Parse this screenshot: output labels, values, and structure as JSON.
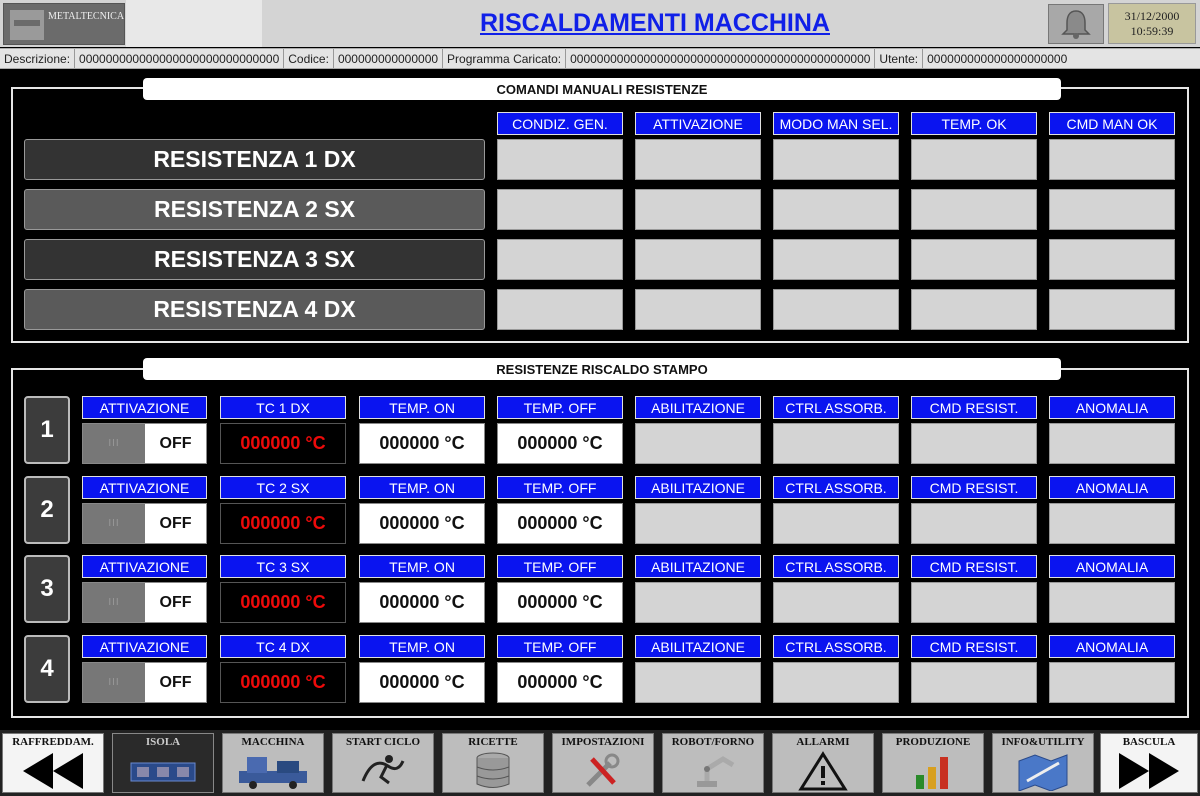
{
  "header": {
    "logo_text": "METALTECNICA",
    "title": "RISCALDAMENTI MACCHINA",
    "date": "31/12/2000",
    "time": "10:59:39"
  },
  "info_bar": {
    "descrizione_label": "Descrizione:",
    "descrizione_value": "000000000000000000000000000000",
    "codice_label": "Codice:",
    "codice_value": "000000000000000",
    "programma_label": "Programma Caricato:",
    "programma_value": "000000000000000000000000000000000000000000000",
    "utente_label": "Utente:",
    "utente_value": "000000000000000000000"
  },
  "manual": {
    "title": "COMANDI MANUALI RESISTENZE",
    "columns": [
      "CONDIZ. GEN.",
      "ATTIVAZIONE",
      "MODO MAN SEL.",
      "TEMP. OK",
      "CMD MAN OK"
    ],
    "rows": [
      "RESISTENZA 1 DX",
      "RESISTENZA 2 SX",
      "RESISTENZA 3 SX",
      "RESISTENZA 4 DX"
    ]
  },
  "mold": {
    "title": "RESISTENZE RISCALDO STAMPO",
    "rows": [
      {
        "num": "1",
        "attivazione": "ATTIVAZIONE",
        "toggle": "OFF",
        "tc_label": "TC 1 DX",
        "tc_value": "000000 °C",
        "temp_on_label": "TEMP. ON",
        "temp_on": "000000 °C",
        "temp_off_label": "TEMP. OFF",
        "temp_off": "000000 °C",
        "abil": "ABILITAZIONE",
        "ctrl": "CTRL ASSORB.",
        "cmd": "CMD RESIST.",
        "anom": "ANOMALIA"
      },
      {
        "num": "2",
        "attivazione": "ATTIVAZIONE",
        "toggle": "OFF",
        "tc_label": "TC 2 SX",
        "tc_value": "000000 °C",
        "temp_on_label": "TEMP. ON",
        "temp_on": "000000 °C",
        "temp_off_label": "TEMP. OFF",
        "temp_off": "000000 °C",
        "abil": "ABILITAZIONE",
        "ctrl": "CTRL ASSORB.",
        "cmd": "CMD RESIST.",
        "anom": "ANOMALIA"
      },
      {
        "num": "3",
        "attivazione": "ATTIVAZIONE",
        "toggle": "OFF",
        "tc_label": "TC 3 SX",
        "tc_value": "000000 °C",
        "temp_on_label": "TEMP. ON",
        "temp_on": "000000 °C",
        "temp_off_label": "TEMP. OFF",
        "temp_off": "000000 °C",
        "abil": "ABILITAZIONE",
        "ctrl": "CTRL ASSORB.",
        "cmd": "CMD RESIST.",
        "anom": "ANOMALIA"
      },
      {
        "num": "4",
        "attivazione": "ATTIVAZIONE",
        "toggle": "OFF",
        "tc_label": "TC 4 DX",
        "tc_value": "000000 °C",
        "temp_on_label": "TEMP. ON",
        "temp_on": "000000 °C",
        "temp_off_label": "TEMP. OFF",
        "temp_off": "000000 °C",
        "abil": "ABILITAZIONE",
        "ctrl": "CTRL ASSORB.",
        "cmd": "CMD RESIST.",
        "anom": "ANOMALIA"
      }
    ]
  },
  "nav": [
    {
      "label": "RAFFREDDAM.",
      "icon": "double-left-arrow-icon"
    },
    {
      "label": "ISOLA",
      "icon": "isola-icon"
    },
    {
      "label": "MACCHINA",
      "icon": "machine-icon"
    },
    {
      "label": "START CICLO",
      "icon": "start-cycle-icon"
    },
    {
      "label": "RICETTE",
      "icon": "database-icon"
    },
    {
      "label": "IMPOSTAZIONI",
      "icon": "settings-tools-icon"
    },
    {
      "label": "ROBOT/FORNO",
      "icon": "robot-arm-icon"
    },
    {
      "label": "ALLARMI",
      "icon": "warning-icon"
    },
    {
      "label": "PRODUZIONE",
      "icon": "bar-chart-icon"
    },
    {
      "label": "INFO&UTILITY",
      "icon": "map-tools-icon"
    },
    {
      "label": "BASCULA",
      "icon": "double-right-arrow-icon"
    }
  ]
}
